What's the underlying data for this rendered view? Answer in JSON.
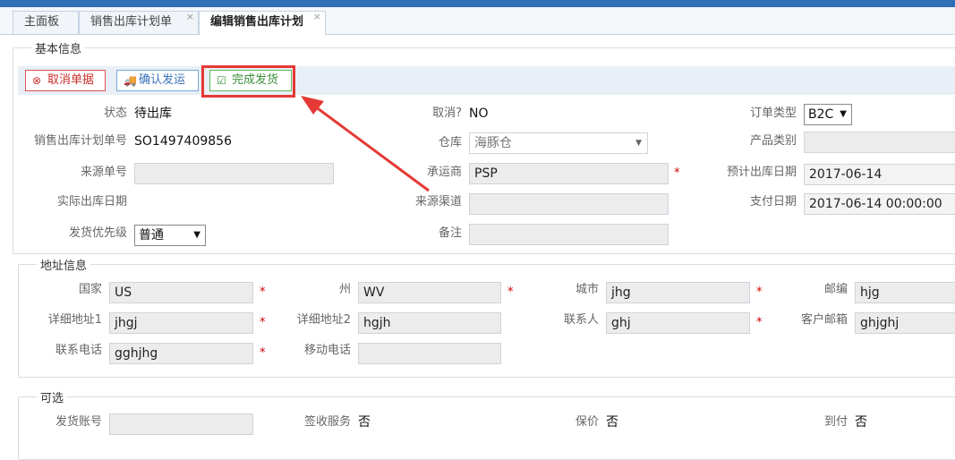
{
  "tabs": [
    "主面板",
    "销售出库计划单",
    "编辑销售出库计划"
  ],
  "close_glyph": "×",
  "sections": {
    "basic": "基本信息",
    "address": "地址信息",
    "optional": "可选"
  },
  "toolbar": {
    "cancel": "取消单据",
    "confirm": "确认发运",
    "done": "完成发货"
  },
  "basic": {
    "status_label": "状态",
    "status_value": "待出库",
    "cancelled_label": "取消?",
    "cancelled_value": "NO",
    "order_type_label": "订单类型",
    "order_type_value": "B2C",
    "plan_no_label": "销售出库计划单号",
    "plan_no_value": "SO1497409856",
    "warehouse_label": "仓库",
    "warehouse_value": "海豚仓",
    "product_cat_label": "产品类别",
    "product_cat_value": "",
    "source_no_label": "来源单号",
    "source_no_value": "",
    "carrier_label": "承运商",
    "carrier_value": "PSP",
    "est_date_label": "预计出库日期",
    "est_date_value": "2017-06-14",
    "actual_date_label": "实际出库日期",
    "channel_label": "来源渠道",
    "channel_value": "",
    "pay_date_label": "支付日期",
    "pay_date_value": "2017-06-14 00:00:00",
    "priority_label": "发货优先级",
    "priority_value": "普通",
    "remark_label": "备注",
    "remark_value": ""
  },
  "address": {
    "country_label": "国家",
    "country_value": "US",
    "state_label": "州",
    "state_value": "WV",
    "city_label": "城市",
    "city_value": "jhg",
    "zip_label": "邮编",
    "zip_value": "hjg",
    "addr1_label": "详细地址1",
    "addr1_value": "jhgj",
    "addr2_label": "详细地址2",
    "addr2_value": "hgjh",
    "contact_label": "联系人",
    "contact_value": "ghj",
    "email_label": "客户邮箱",
    "email_value": "ghjghj",
    "phone_label": "联系电话",
    "phone_value": "gghjhg",
    "mobile_label": "移动电话",
    "mobile_value": ""
  },
  "optional": {
    "account_label": "发货账号",
    "account_value": "",
    "sign_label": "签收服务",
    "sign_value": "否",
    "insure_label": "保价",
    "insure_value": "否",
    "cod_label": "到付",
    "cod_value": "否"
  },
  "required_mark": "*",
  "colors": {
    "header": "#2f6fb6",
    "highlight": "#e53935",
    "toolbar": "#e9eff6"
  }
}
